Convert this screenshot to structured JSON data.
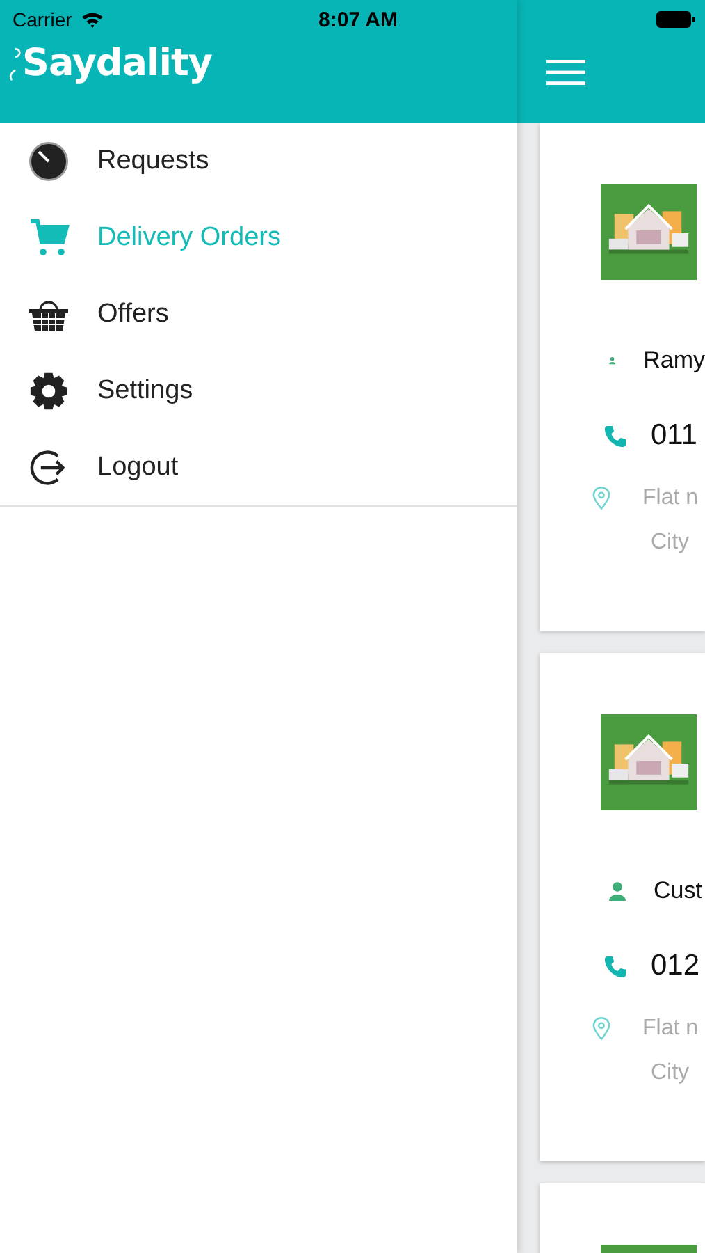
{
  "status_bar": {
    "carrier": "Carrier",
    "time": "8:07 AM"
  },
  "drawer": {
    "brand": "Saydality",
    "items": [
      {
        "label": "Requests",
        "selected": false
      },
      {
        "label": "Delivery Orders",
        "selected": true
      },
      {
        "label": "Offers",
        "selected": false
      },
      {
        "label": "Settings",
        "selected": false
      },
      {
        "label": "Logout",
        "selected": false
      }
    ]
  },
  "orders": [
    {
      "image": {
        "kind": "picture"
      },
      "name": "Ramy",
      "phone": "011",
      "address": "Flat n",
      "city": "City"
    },
    {
      "image": {
        "kind": "picture"
      },
      "name": "Cust",
      "phone": "012",
      "address": "Flat n",
      "city": "City"
    },
    {
      "image": {
        "kind": "picture"
      }
    }
  ]
}
